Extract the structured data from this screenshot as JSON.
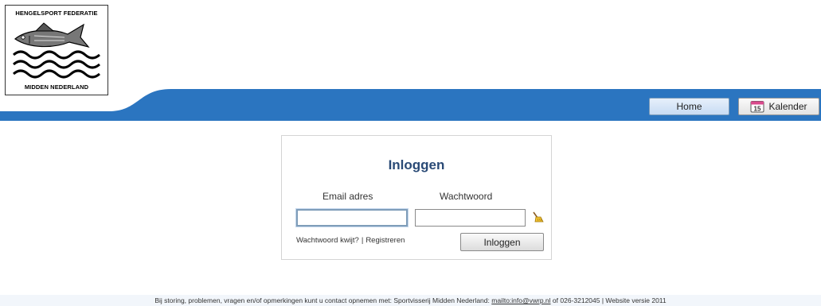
{
  "logo": {
    "top_text": "HENGELSPORT FEDERATIE",
    "bottom_text": "MIDDEN NEDERLAND"
  },
  "nav": {
    "home_label": "Home",
    "calendar_label": "Kalender",
    "calendar_day": "15"
  },
  "login": {
    "title": "Inloggen",
    "email_label": "Email adres",
    "password_label": "Wachtwoord",
    "email_value": "",
    "password_value": "",
    "forgot_link": "Wachtwoord kwijt?",
    "separator": "|",
    "register_link": "Registreren",
    "submit_label": "Inloggen"
  },
  "footer": {
    "prefix": "Bij storing, problemen, vragen en/of opmerkingen kunt u contact opnemen met: Sportvisserij Midden Nederland:",
    "mail_link": "mailto:info@vwrp.nl",
    "suffix": "of 026-3212045 | Website versie 2011"
  },
  "colors": {
    "band_blue": "#2b75c0",
    "title_blue": "#2a4a76"
  }
}
